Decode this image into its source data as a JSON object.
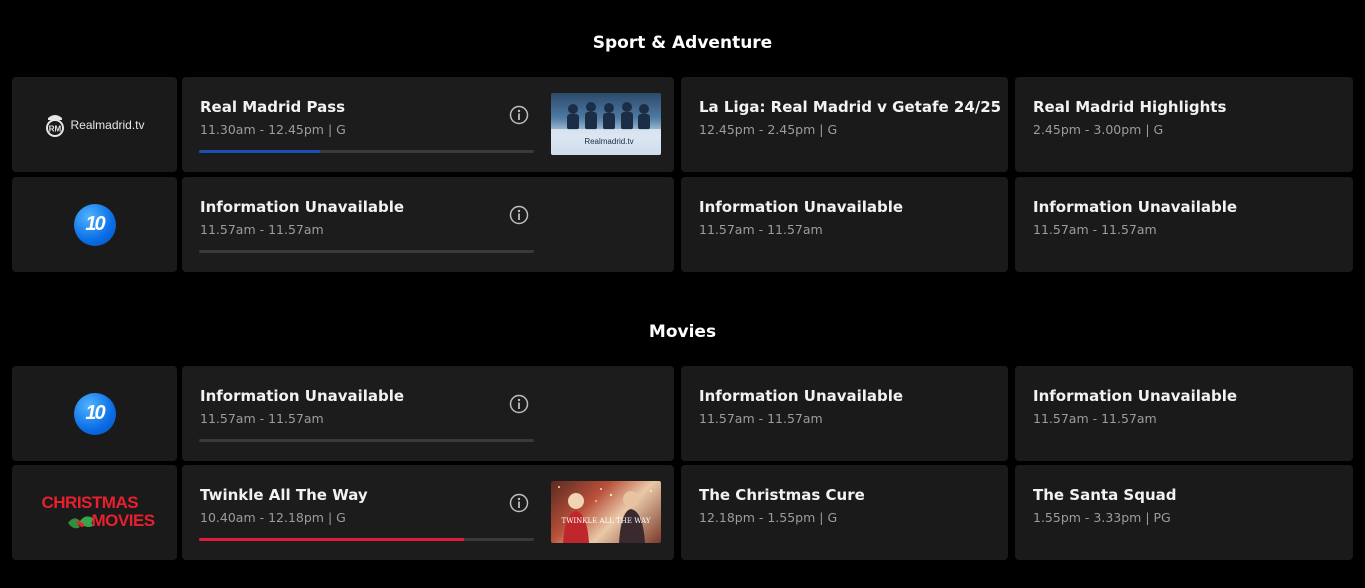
{
  "colors": {
    "progress_blue": "#1b4fb0",
    "progress_red": "#e01b3c",
    "background": "#000000",
    "card": "#1a1a1a"
  },
  "sections": [
    {
      "title": "Sport & Adventure"
    },
    {
      "title": "Movies"
    }
  ],
  "channels": {
    "realmadrid": {
      "logo_text": "Realmadrid.tv",
      "icon": "realmadrid-crest-icon"
    },
    "ten_a": {
      "logo_text": "10",
      "icon": "channel-10-logo"
    },
    "ten_b": {
      "logo_text": "10",
      "icon": "channel-10-logo"
    },
    "christmas": {
      "logo_line1": "CHRISTMAS",
      "logo_line2": "MOVIES",
      "icon": "holly-icon"
    }
  },
  "rows": {
    "rm": {
      "now": {
        "title": "Real Madrid Pass",
        "meta": "11.30am - 12.45pm  |  G",
        "progress": 0.36,
        "thumb_text": "Realmadrid.tv"
      },
      "next": {
        "title": "La Liga: Real Madrid v Getafe 24/25",
        "meta": "12.45pm - 2.45pm  |  G"
      },
      "later": {
        "title": "Real Madrid Highlights",
        "meta": "2.45pm - 3.00pm  |  G"
      }
    },
    "ten1": {
      "now": {
        "title": "Information Unavailable",
        "meta": "11.57am - 11.57am",
        "progress": 0
      },
      "next": {
        "title": "Information Unavailable",
        "meta": "11.57am - 11.57am"
      },
      "later": {
        "title": "Information Unavailable",
        "meta": "11.57am - 11.57am"
      }
    },
    "ten2": {
      "now": {
        "title": "Information Unavailable",
        "meta": "11.57am - 11.57am",
        "progress": 0
      },
      "next": {
        "title": "Information Unavailable",
        "meta": "11.57am - 11.57am"
      },
      "later": {
        "title": "Information Unavailable",
        "meta": "11.57am - 11.57am"
      }
    },
    "xmas": {
      "now": {
        "title": "Twinkle All The Way",
        "meta": "10.40am - 12.18pm  |  G",
        "progress": 0.79,
        "thumb_text": "TWINKLE ALL THE WAY"
      },
      "next": {
        "title": "The Christmas Cure",
        "meta": "12.18pm - 1.55pm  |  G"
      },
      "later": {
        "title": "The Santa Squad",
        "meta": "1.55pm - 3.33pm  |  PG"
      }
    }
  }
}
